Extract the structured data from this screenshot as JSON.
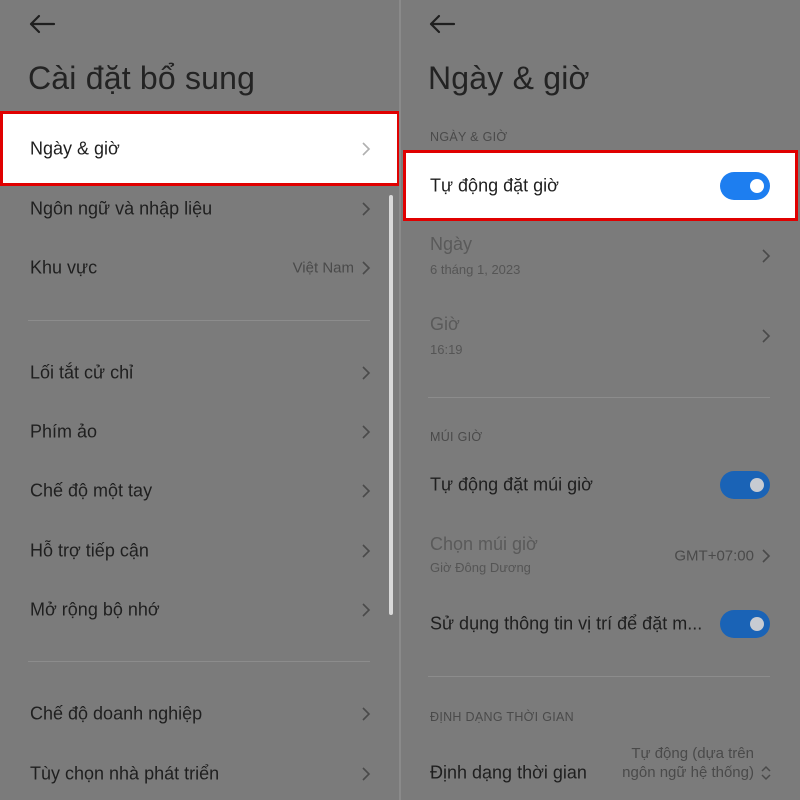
{
  "left": {
    "title": "Cài đặt bổ sung",
    "items": [
      {
        "label": "Ngày & giờ"
      },
      {
        "label": "Ngôn ngữ và nhập liệu"
      },
      {
        "label": "Khu vực",
        "value": "Việt Nam"
      },
      {
        "label": "Lối tắt cử chỉ"
      },
      {
        "label": "Phím ảo"
      },
      {
        "label": "Chế độ một tay"
      },
      {
        "label": "Hỗ trợ tiếp cận"
      },
      {
        "label": "Mở rộng bộ nhớ"
      },
      {
        "label": "Chế độ doanh nghiệp"
      },
      {
        "label": "Tùy chọn nhà phát triển"
      }
    ]
  },
  "right": {
    "title": "Ngày & giờ",
    "section_datetime": "NGÀY & GIỜ",
    "auto_time": {
      "label": "Tự động đặt giờ",
      "on": true
    },
    "date": {
      "label": "Ngày",
      "value": "6 tháng 1, 2023"
    },
    "time": {
      "label": "Giờ",
      "value": "16:19"
    },
    "section_timezone": "MÚI GIỜ",
    "auto_timezone": {
      "label": "Tự động đặt múi giờ",
      "on": true
    },
    "choose_timezone": {
      "label": "Chọn múi giờ",
      "sub": "Giờ Đông Dương",
      "value": "GMT+07:00"
    },
    "use_location": {
      "label": "Sử dụng thông tin vị trí để đặt m...",
      "on": true
    },
    "section_format": "ĐỊNH DẠNG THỜI GIAN",
    "time_format": {
      "label": "Định dạng thời gian",
      "value": "Tự động (dựa trên ngôn ngữ hệ thống)"
    }
  },
  "colors": {
    "highlight_border": "#e00000",
    "toggle_on": "#1d7ef0",
    "dim_background": "#7b7b7b"
  },
  "icons": {
    "back": "arrow-left-icon",
    "chevron": "chevron-right-icon",
    "updown": "chevron-up-down-icon"
  }
}
